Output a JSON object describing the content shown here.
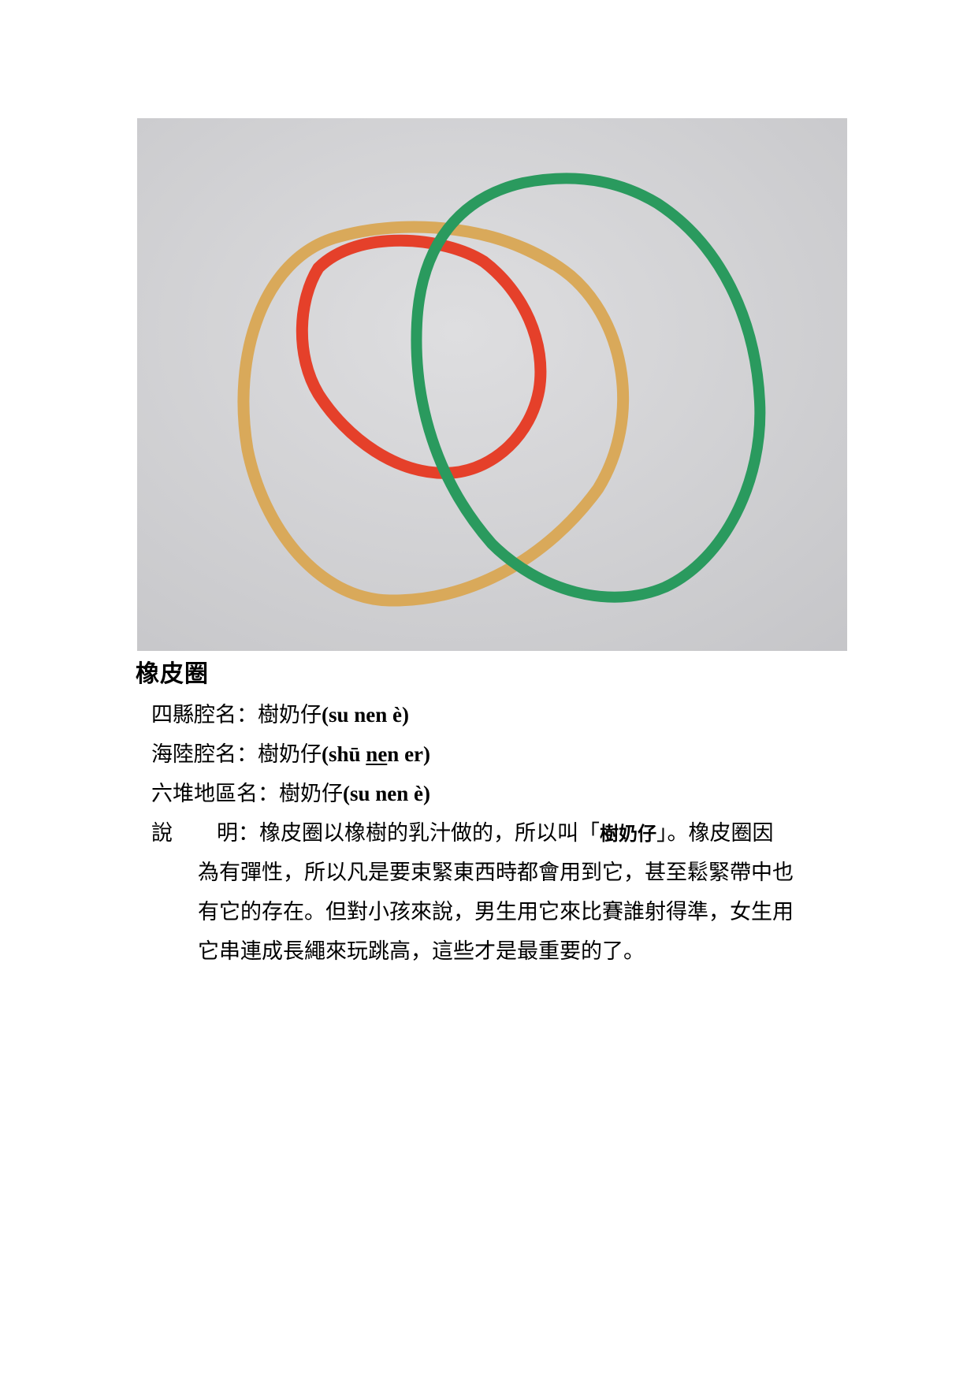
{
  "title": "橡皮圈",
  "names": [
    {
      "label": "四縣腔名",
      "colon": "：",
      "term": "樹奶仔",
      "roman_open": "(",
      "roman_a": "su nen è",
      "roman_under": "",
      "roman_b": "",
      "roman_close": ")"
    },
    {
      "label": "海陸腔名",
      "colon": "：",
      "term": "樹奶仔",
      "roman_open": "(",
      "roman_a": "shū ",
      "roman_under": "ne",
      "roman_b": "n er",
      "roman_close": ")"
    },
    {
      "label": "六堆地區名",
      "colon": "：",
      "term": "樹奶仔",
      "roman_open": "(",
      "roman_a": "su nen è",
      "roman_under": "",
      "roman_b": "",
      "roman_close": ")"
    }
  ],
  "description": {
    "label_a": "說",
    "label_b": "明",
    "colon": "：",
    "first_before": "橡皮圈以橡樹的乳汁做的，所以叫「",
    "first_quoted": "樹奶仔",
    "first_after": "」。橡皮圈因",
    "lines": [
      "為有彈性，所以凡是要束緊東西時都會用到它，甚至鬆緊帶中也",
      "有它的存在。但對小孩來說，男生用它來比賽誰射得準，女生用",
      "它串連成長繩來玩跳高，這些才是最重要的了。"
    ]
  },
  "photo": {
    "background": "#d4d4d6",
    "band_colors": {
      "yellow": "#d9a95a",
      "red": "#e5402a",
      "green": "#2a9a5e"
    }
  }
}
